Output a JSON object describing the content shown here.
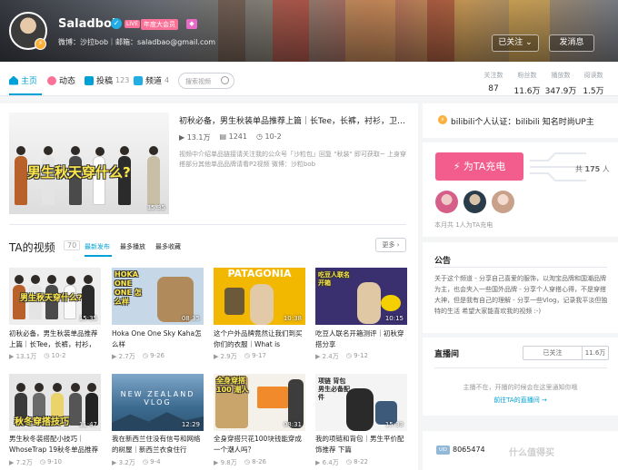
{
  "header": {
    "username": "Saladbob",
    "live_badge": "LIVE",
    "year_badge": "年度大会员",
    "signature": "微博：沙拉bob｜邮箱：saladbao@gmail.com",
    "follow_label": "已关注",
    "message_label": "发消息"
  },
  "nav": {
    "items": [
      {
        "label": "主页",
        "count": ""
      },
      {
        "label": "动态",
        "count": ""
      },
      {
        "label": "投稿",
        "count": "123"
      },
      {
        "label": "频道",
        "count": "4"
      }
    ],
    "search_placeholder": "搜索视频",
    "stats": [
      {
        "label": "关注数",
        "value": "87"
      },
      {
        "label": "粉丝数",
        "value": "11.6万"
      },
      {
        "label": "播放数",
        "value": "347.9万"
      },
      {
        "label": "阅读数",
        "value": "1.5万"
      }
    ]
  },
  "featured": {
    "title": "初秋必备，男生秋装单品推荐上篇｜长Tee，长裤，衬衫，卫衣…",
    "plays": "13.1万",
    "danmaku": "1241",
    "date": "10-2",
    "desc": "视频中介绍单品链接请关注我的公众号「沙粒包」回复 \"秋装\" 即可获取~ 上身穿搭部分其他单品品牌请看P2视频 微博：沙粒bob",
    "thumb_text": "男生秋天穿什么?",
    "duration": "15:35"
  },
  "videos_section": {
    "title": "TA的视频",
    "count": "70",
    "sort_tabs": [
      "最新发布",
      "最多播放",
      "最多收藏"
    ],
    "more": "更多"
  },
  "videos": [
    {
      "title": "初秋必备，男生秋装单品推荐上篇｜长Tee，长裤，衬衫，",
      "plays": "13.1万",
      "date": "10-2",
      "duration": "15:35",
      "thumb_text": "男生秋天穿什么?"
    },
    {
      "title": "Hoka One One Sky Kaha怎么样",
      "plays": "2.7万",
      "date": "9-26",
      "duration": "08:35",
      "thumb_text": "HOKA ONE ONE 怎么样"
    },
    {
      "title": "这个户外品牌竟然让我们到买你们的衣服｜What is",
      "plays": "2.9万",
      "date": "9-17",
      "duration": "10:38",
      "thumb_text": "PATAGONIA"
    },
    {
      "title": "吃豆人联名开箱测评｜初秋穿搭分享",
      "plays": "2.4万",
      "date": "9-12",
      "duration": "10:15",
      "thumb_text": "吃豆人联名开箱"
    },
    {
      "title": "男生秋冬装搭配小技巧｜WhoseTrap 19秋冬单品推荐",
      "plays": "7.2万",
      "date": "9-10",
      "duration": "11:47",
      "thumb_text": "秋冬穿搭技巧"
    },
    {
      "title": "我在新西兰住没有信号和网络的树屋｜新西兰衣食住行",
      "plays": "3.2万",
      "date": "9-4",
      "duration": "12:29",
      "thumb_text": "NEW ZEALAND VLOG"
    },
    {
      "title": "全身穿搭只花100块钱能穿成一个潮人吗？",
      "plays": "9.8万",
      "date": "8-26",
      "duration": "08:31",
      "thumb_text": "全身穿搭 100 潮人"
    },
    {
      "title": "我的项链和背包｜男生平价配饰推荐 下篇",
      "plays": "6.4万",
      "date": "8-22",
      "duration": "15:33",
      "thumb_text": "项链 背包 男生必备配件"
    }
  ],
  "sidebar": {
    "auth_text": "bilibili个人认证：bilibili 知名时尚UP主",
    "charge_label": "为TA充电",
    "charge_total_prefix": "共",
    "charge_total": "175",
    "charge_total_suffix": "人",
    "charge_foot": "本月共 1人为TA充电",
    "notice_title": "公告",
    "notice_body": "关于这个频道 - 分享自己喜爱的服饰，以淘宝品牌和国潮品牌为主，也会夹入一些国外品牌 - 分享个人穿搭心得，不是穿搭大神，但是我有自己的理解 - 分享一些Vlog，记录我平淡但独特的生活 希望大家能喜欢我的视频 :-)",
    "live_title": "直播间",
    "live_follow": "已关注",
    "live_count": "11.6万",
    "live_empty": "主播不在，开播的时候会在这里通知你哦",
    "live_link": "前往TA的直播间 →",
    "uid_label": "UID",
    "uid": "8065474",
    "watermark": "什么值得买"
  }
}
